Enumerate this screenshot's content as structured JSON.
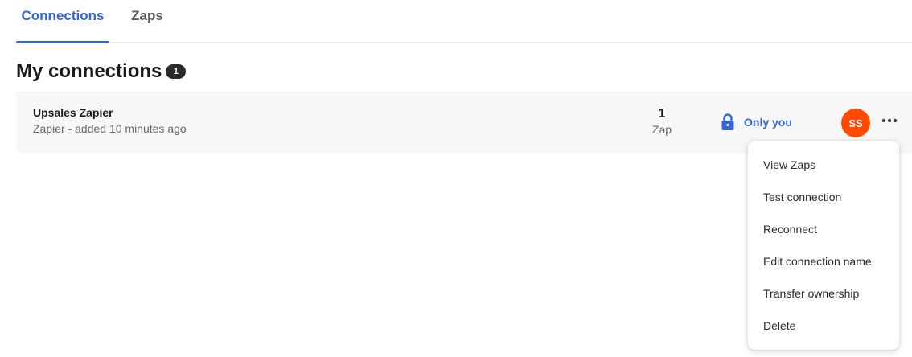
{
  "tabs": [
    {
      "label": "Connections",
      "active": true
    },
    {
      "label": "Zaps",
      "active": false
    }
  ],
  "heading": {
    "title": "My connections",
    "count": "1"
  },
  "connection": {
    "name": "Upsales Zapier",
    "subtitle": "Zapier - added 10 minutes ago",
    "zap_count": "1",
    "zap_unit": "Zap",
    "access_label": "Only you",
    "access_icon": "lock-icon",
    "avatar_initials": "SS",
    "more_icon": "more-horizontal-icon"
  },
  "menu": {
    "items": [
      {
        "label": "View Zaps"
      },
      {
        "label": "Test connection"
      },
      {
        "label": "Reconnect"
      },
      {
        "label": "Edit connection name"
      },
      {
        "label": "Transfer ownership"
      },
      {
        "label": "Delete"
      }
    ]
  },
  "colors": {
    "accent": "#3467d4",
    "avatar_bg": "#ff4a00",
    "card_bg": "#f7f7f7",
    "badge_bg": "#2b2b2b"
  }
}
